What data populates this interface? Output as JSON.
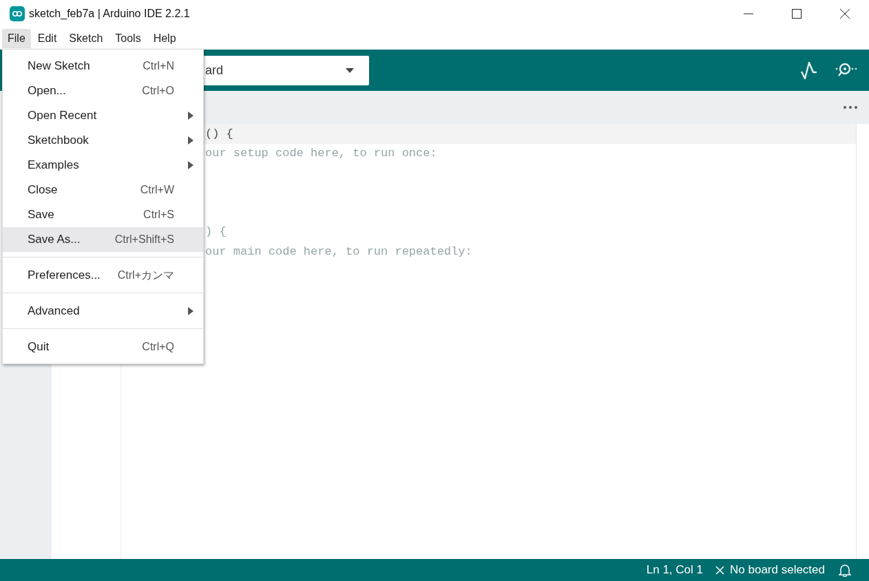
{
  "window": {
    "title": "sketch_feb7a | Arduino IDE 2.2.1"
  },
  "menubar": [
    {
      "label": "File",
      "selected": true
    },
    {
      "label": "Edit",
      "selected": false
    },
    {
      "label": "Sketch",
      "selected": false
    },
    {
      "label": "Tools",
      "selected": false
    },
    {
      "label": "Help",
      "selected": false
    }
  ],
  "toolbar": {
    "board_selector": {
      "value": "ard"
    }
  },
  "editor": {
    "lines": [
      {
        "text": "() {",
        "current": true
      },
      {
        "text": "our setup code here, to run once:",
        "current": false
      },
      {
        "current": false
      },
      {
        "current": false
      },
      {
        "current": false
      },
      {
        "text": ") {",
        "current": false
      },
      {
        "text": "our main code here, to run repeatedly:",
        "current": false
      }
    ]
  },
  "file_menu": [
    {
      "kind": "item",
      "label": "New Sketch",
      "shortcut": "Ctrl+N",
      "selected": false
    },
    {
      "kind": "item",
      "label": "Open...",
      "shortcut": "Ctrl+O",
      "selected": false
    },
    {
      "kind": "submenu",
      "label": "Open Recent",
      "selected": false
    },
    {
      "kind": "submenu",
      "label": "Sketchbook",
      "selected": false
    },
    {
      "kind": "submenu",
      "label": "Examples",
      "selected": false
    },
    {
      "kind": "item",
      "label": "Close",
      "shortcut": "Ctrl+W",
      "selected": false
    },
    {
      "kind": "item",
      "label": "Save",
      "shortcut": "Ctrl+S",
      "selected": false
    },
    {
      "kind": "item",
      "label": "Save As...",
      "shortcut": "Ctrl+Shift+S",
      "selected": true
    },
    {
      "kind": "separator"
    },
    {
      "kind": "item",
      "label": "Preferences...",
      "shortcut": "Ctrl+カンマ",
      "selected": false
    },
    {
      "kind": "separator"
    },
    {
      "kind": "submenu",
      "label": "Advanced",
      "selected": false
    },
    {
      "kind": "separator"
    },
    {
      "kind": "item",
      "label": "Quit",
      "shortcut": "Ctrl+Q",
      "selected": false
    }
  ],
  "status_bar": {
    "position": "Ln 1, Col 1",
    "board": "No board selected"
  }
}
